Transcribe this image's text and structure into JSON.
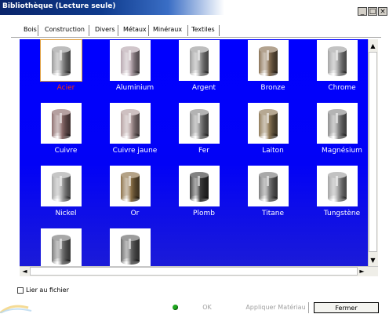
{
  "window": {
    "title": "Bibliothèque (Lecture seule)",
    "controls": [
      {
        "name": "minimize",
        "glyph": "_"
      },
      {
        "name": "maximize",
        "glyph": "□"
      },
      {
        "name": "close",
        "glyph": "×"
      }
    ]
  },
  "tabs": [
    {
      "label": "Bois",
      "active": false
    },
    {
      "label": "Construction",
      "active": false
    },
    {
      "label": "Divers",
      "active": false
    },
    {
      "label": "Métaux",
      "active": true
    },
    {
      "label": "Minéraux",
      "active": false
    },
    {
      "label": "Textiles",
      "active": false
    }
  ],
  "materials": [
    {
      "label": "Acier",
      "color": "#9a9a9a",
      "selected": true
    },
    {
      "label": "Aluminium",
      "color": "#b8a8b0",
      "selected": false
    },
    {
      "label": "Argent",
      "color": "#9c9c9c",
      "selected": false
    },
    {
      "label": "Bronze",
      "color": "#8a7255",
      "selected": false
    },
    {
      "label": "Chrome",
      "color": "#a3a3a3",
      "selected": false
    },
    {
      "label": "Cuivre",
      "color": "#8e6e6e",
      "selected": false
    },
    {
      "label": "Cuivre jaune",
      "color": "#b49fa0",
      "selected": false
    },
    {
      "label": "Fer",
      "color": "#8a8a8a",
      "selected": false
    },
    {
      "label": "Laiton",
      "color": "#8f7a58",
      "selected": false
    },
    {
      "label": "Magnésium",
      "color": "#8d8d8d",
      "selected": false
    },
    {
      "label": "Nickel",
      "color": "#a8a8a8",
      "selected": false
    },
    {
      "label": "Or",
      "color": "#8c7148",
      "selected": false
    },
    {
      "label": "Plomb",
      "color": "#3e3e3e",
      "selected": false
    },
    {
      "label": "Titane",
      "color": "#7c7c7c",
      "selected": false
    },
    {
      "label": "Tungstène",
      "color": "#a2a2a2",
      "selected": false
    },
    {
      "label": "",
      "color": "#7a7a7a",
      "selected": false
    },
    {
      "label": "",
      "color": "#686868",
      "selected": false
    }
  ],
  "scroll": {
    "up": "▲",
    "down": "▼",
    "left": "◄",
    "right": "►"
  },
  "options": {
    "link_label": "Lier au fichier",
    "link_checked": false
  },
  "buttons": {
    "ok": "OK",
    "apply": "Appliquer Matériau",
    "close": "Fermer"
  }
}
